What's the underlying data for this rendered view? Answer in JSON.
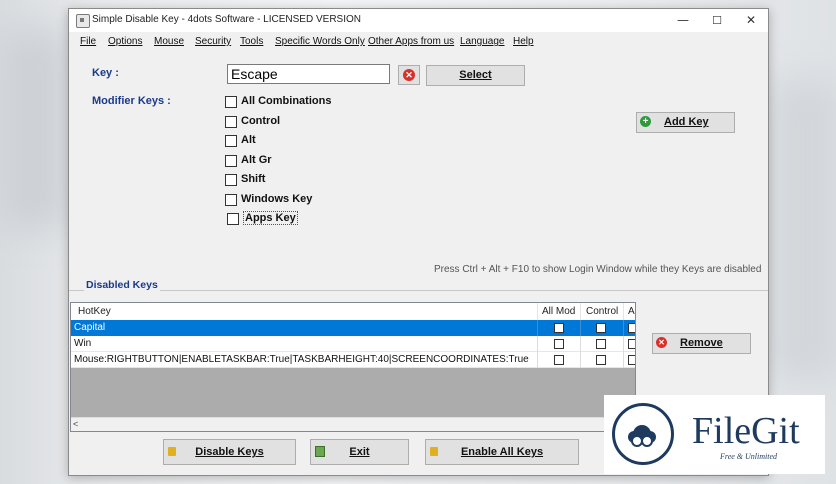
{
  "window": {
    "title": "Simple Disable Key - 4dots Software - LICENSED VERSION",
    "controls": {
      "minimize": "—",
      "maximize": "☐",
      "close": "✕"
    }
  },
  "menu": [
    "File",
    "Options",
    "Mouse",
    "Security",
    "Tools",
    "Specific Words Only",
    "Other Apps from us",
    "Language",
    "Help"
  ],
  "form": {
    "key_label": "Key :",
    "key_value": "Escape",
    "select_label": "Select",
    "modifier_label": "Modifier Keys :",
    "modifiers": [
      {
        "label": "All Combinations",
        "checked": false
      },
      {
        "label": "Control",
        "checked": false
      },
      {
        "label": "Alt",
        "checked": false
      },
      {
        "label": "Alt Gr",
        "checked": false
      },
      {
        "label": "Shift",
        "checked": false
      },
      {
        "label": "Windows Key",
        "checked": false
      },
      {
        "label": "Apps Key",
        "checked": false
      }
    ],
    "add_key_label": "Add Key"
  },
  "hint": "Press Ctrl + Alt + F10 to show Login Window while they Keys are disabled",
  "disabled_keys": {
    "group_label": "Disabled Keys",
    "columns": [
      "HotKey",
      "All Mod",
      "Control",
      "Al"
    ],
    "rows": [
      {
        "hotkey": "Capital",
        "selected": true
      },
      {
        "hotkey": "Win",
        "selected": false
      },
      {
        "hotkey": "Mouse:RIGHTBUTTON|ENABLETASKBAR:True|TASKBARHEIGHT:40|SCREENCOORDINATES:True",
        "selected": false
      }
    ],
    "scroll_left": "<"
  },
  "buttons": {
    "remove": "Remove",
    "disable_keys": "Disable Keys",
    "exit": "Exit",
    "enable_all_keys": "Enable All Keys"
  },
  "watermark": {
    "brand": "FileGit",
    "tagline": "Free & Unlimited"
  },
  "colors": {
    "accent": "#0078d7",
    "label_blue": "#1a3a8a",
    "brand": "#1f3a5f"
  }
}
